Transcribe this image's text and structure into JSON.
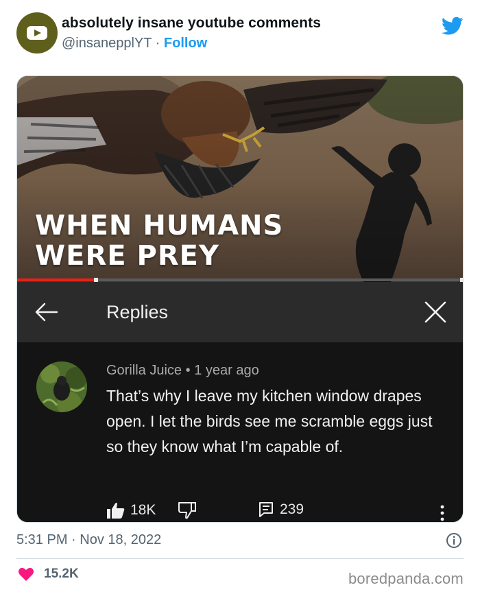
{
  "tweet": {
    "display_name": "absolutely insane youtube comments",
    "handle": "@insanepplYT",
    "separator": "·",
    "follow_label": "Follow",
    "timestamp": "5:31 PM · Nov 18, 2022",
    "like_count": "15.2K"
  },
  "video": {
    "title": "WHEN HUMANS\nWERE PREY",
    "progress_fraction": 0.17
  },
  "replies_panel": {
    "title": "Replies"
  },
  "comment": {
    "author": "Gorilla Juice",
    "bullet": "•",
    "age": "1 year ago",
    "text": "That’s why I leave my kitchen window drapes open. I let the birds see me scramble eggs just so they know what I’m capable of.",
    "likes": "18K",
    "replies": "239"
  },
  "watermark": "boredpanda.com",
  "colors": {
    "twitter_blue": "#1d9bf0",
    "like_heart": "#f91880",
    "yt_red": "#e62117",
    "avatar_olive": "#5f5f1c"
  },
  "icons": [
    "youtube-play-icon",
    "twitter-bird-icon",
    "back-arrow-icon",
    "close-icon",
    "thumbs-up-icon",
    "thumbs-down-icon",
    "reply-icon",
    "more-vert-icon",
    "info-icon",
    "heart-icon"
  ]
}
